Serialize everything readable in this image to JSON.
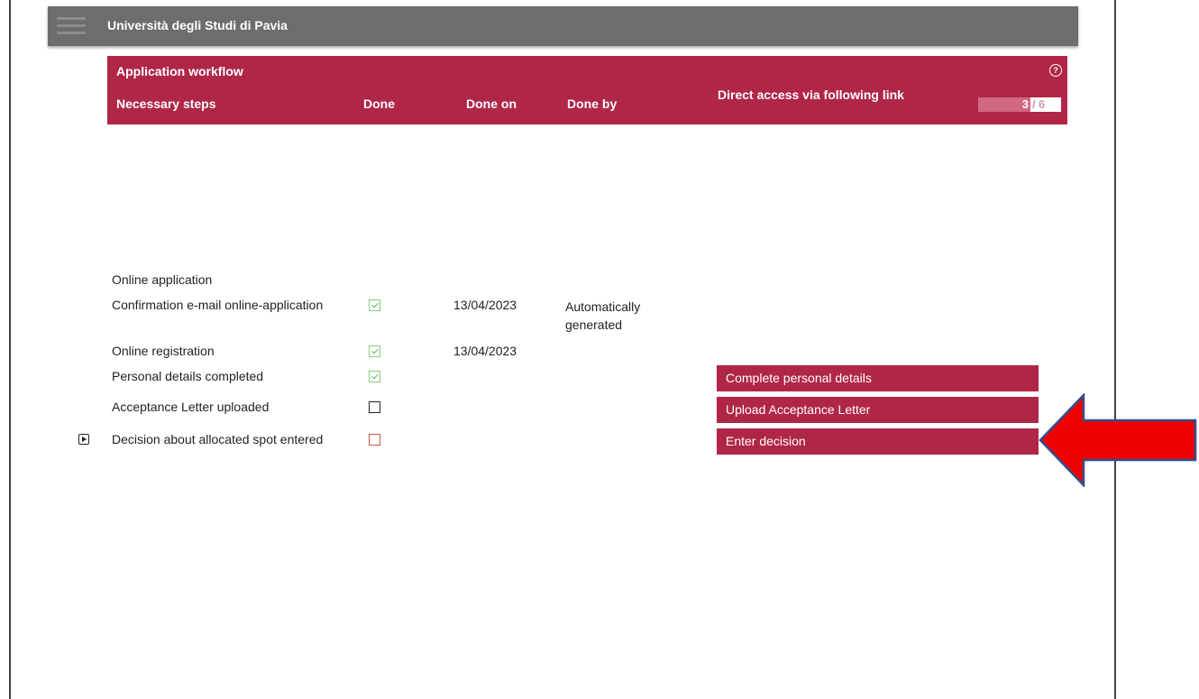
{
  "header": {
    "title": "Università degli Studi di Pavia"
  },
  "workflow": {
    "title": "Application workflow",
    "columns": {
      "steps": "Necessary steps",
      "done": "Done",
      "done_on": "Done on",
      "done_by": "Done by",
      "link": "Direct access via following link"
    },
    "pager": {
      "current": "3",
      "separator": "/",
      "total": "6"
    },
    "steps": [
      {
        "label": "Online application",
        "status": "none",
        "date": "",
        "by": ""
      },
      {
        "label": "Confirmation e-mail online-application",
        "status": "checked",
        "date": "13/04/2023",
        "by": "Automatically generated"
      },
      {
        "label": "Online registration",
        "status": "checked",
        "date": "13/04/2023",
        "by": ""
      },
      {
        "label": "Personal details completed",
        "status": "checked",
        "date": "",
        "by": ""
      },
      {
        "label": "Acceptance Letter uploaded",
        "status": "empty",
        "date": "",
        "by": ""
      },
      {
        "label": "Decision about allocated spot entered",
        "status": "pending",
        "date": "",
        "by": ""
      }
    ],
    "actions": [
      {
        "label": "Complete personal details"
      },
      {
        "label": "Upload Acceptance Letter"
      },
      {
        "label": "Enter decision"
      }
    ]
  },
  "colors": {
    "accent": "#b02647",
    "topbar": "#6d6d6d",
    "check": "#5cb85c",
    "pending": "#d9534f",
    "arrow": "#ee0000",
    "arrow_border": "#2f4f8f"
  },
  "icons": {
    "menu": "hamburger-icon",
    "help": "help-icon",
    "current_step": "play-icon",
    "annotation": "arrow-left-icon"
  }
}
